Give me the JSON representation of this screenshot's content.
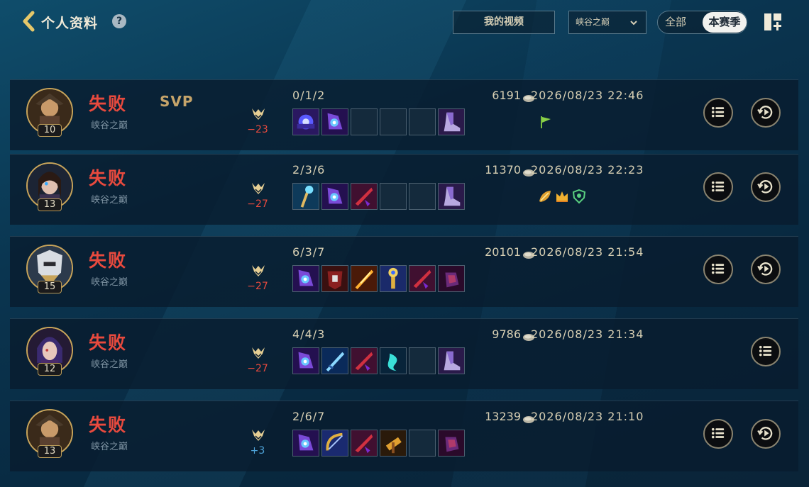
{
  "header": {
    "title": "个人资料",
    "help_icon": "question-icon",
    "video_button": "我的视频",
    "mode_select": {
      "selected": "峡谷之巅"
    },
    "season_toggle": {
      "all": "全部",
      "season": "本赛季",
      "active": "season"
    }
  },
  "colors": {
    "defeat": "#e84a3e",
    "rank_loss": "#e84a3e",
    "rank_gain": "#4ea3d8",
    "gold_text": "#c5a46a"
  },
  "matches": [
    {
      "level": "10",
      "result": "失败",
      "mode": "峡谷之巅",
      "svp": "SVP",
      "rank_change": "−23",
      "kda": "0/1/2",
      "gold": "6191",
      "datetime": "2026/08/23 22:46",
      "items": [
        "purple-gauntlet",
        "purple-boots-orb",
        "empty",
        "empty",
        "empty",
        "purple-boots"
      ],
      "badges": [
        "green-flag"
      ],
      "has_replay": true
    },
    {
      "level": "13",
      "result": "失败",
      "mode": "峡谷之巅",
      "svp": "",
      "rank_change": "−27",
      "kda": "2/3/6",
      "gold": "11370",
      "datetime": "2026/08/23 22:23",
      "items": [
        "gold-staff",
        "purple-boots-orb",
        "red-blade",
        "empty",
        "empty",
        "purple-boots"
      ],
      "badges": [
        "yellow-leaf",
        "yellow-crown",
        "green-shield"
      ],
      "has_replay": true
    },
    {
      "level": "15",
      "result": "失败",
      "mode": "峡谷之巅",
      "svp": "",
      "rank_change": "−27",
      "kda": "6/3/7",
      "gold": "20101",
      "datetime": "2026/08/23 21:54",
      "items": [
        "purple-boots-orb",
        "red-armor",
        "fire-sword",
        "gold-scepter",
        "red-blade",
        "dark-glove"
      ],
      "badges": [],
      "has_replay": true
    },
    {
      "level": "12",
      "result": "失败",
      "mode": "峡谷之巅",
      "svp": "",
      "rank_change": "−27",
      "kda": "4/4/3",
      "gold": "9786",
      "datetime": "2026/08/23 21:34",
      "items": [
        "purple-boots-orb",
        "ice-blade",
        "red-blade",
        "cyan-spirit",
        "empty",
        "purple-boots"
      ],
      "badges": [],
      "has_replay": false
    },
    {
      "level": "13",
      "result": "失败",
      "mode": "峡谷之巅",
      "svp": "",
      "rank_change": "+3",
      "kda": "2/6/7",
      "gold": "13239",
      "datetime": "2026/08/23 21:10",
      "items": [
        "purple-boots-orb",
        "blue-gold-bow",
        "red-blade",
        "gold-hammer",
        "empty",
        "dark-glove"
      ],
      "badges": [],
      "has_replay": true
    }
  ]
}
